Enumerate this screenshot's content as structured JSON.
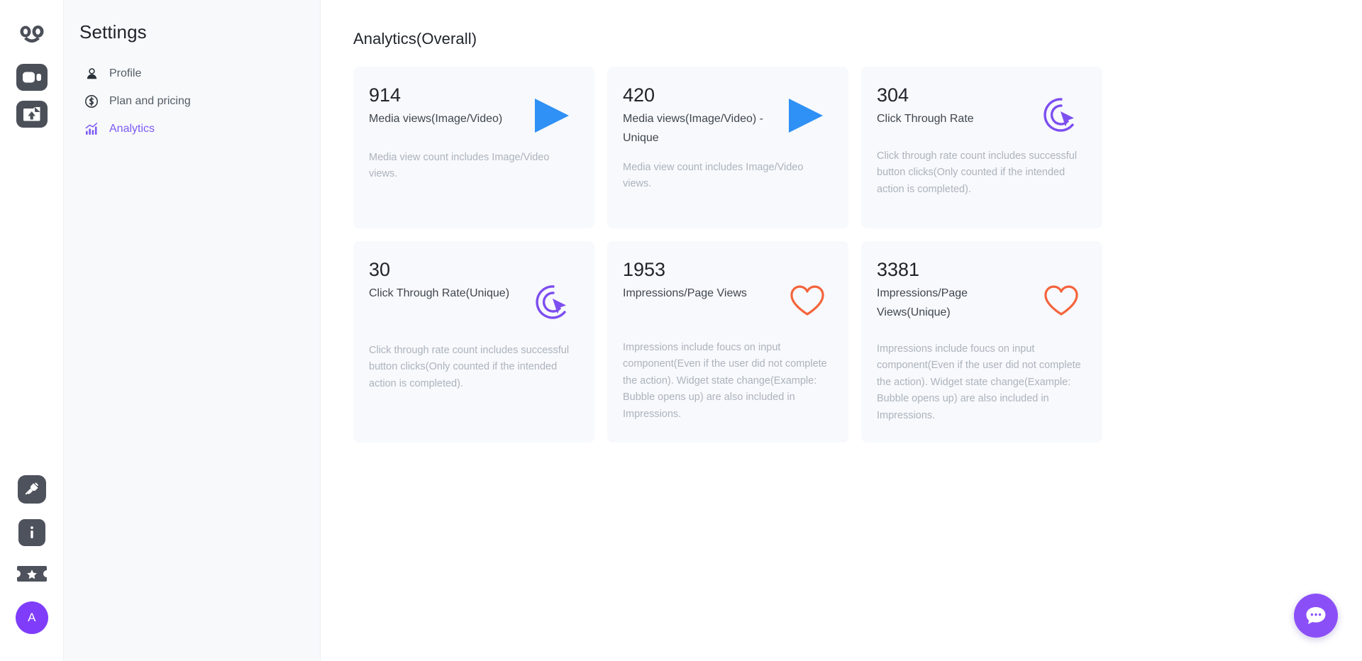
{
  "rail": {
    "logo": {
      "name": "app-logo-smiley"
    },
    "items": [
      {
        "name": "video-icon",
        "label": "Video"
      },
      {
        "name": "upload-icon",
        "label": "Upload"
      }
    ],
    "bottom_items": [
      {
        "name": "plug-integrations-icon",
        "label": "Integrations"
      },
      {
        "name": "info-icon",
        "label": "Info"
      },
      {
        "name": "ticket-star-icon",
        "label": "Rewards"
      }
    ],
    "avatar": {
      "initial": "A"
    }
  },
  "settings": {
    "title": "Settings",
    "nav": [
      {
        "label": "Profile",
        "icon": "person-icon",
        "active": false
      },
      {
        "label": "Plan and pricing",
        "icon": "dollar-circle-icon",
        "active": false
      },
      {
        "label": "Analytics",
        "icon": "chart-bars-icon",
        "active": true
      }
    ]
  },
  "main": {
    "title": "Analytics(Overall)",
    "cards": [
      {
        "value": "914",
        "label": "Media views(Image/Video)",
        "description": "Media view count includes Image/Video views.",
        "icon": "play-icon",
        "icon_color": "#2f90f5"
      },
      {
        "value": "420",
        "label": "Media views(Image/Video) - Unique",
        "description": "Media view count includes Image/Video views.",
        "icon": "play-icon",
        "icon_color": "#2f90f5"
      },
      {
        "value": "304",
        "label": "Click Through Rate",
        "description": "Click through rate count includes successful button clicks(Only counted if the intended action is completed).",
        "icon": "click-target-icon",
        "icon_color": "#7d4ef0"
      },
      {
        "value": "30",
        "label": "Click Through Rate(Unique)",
        "description": "Click through rate count includes successful button clicks(Only counted if the intended action is completed).",
        "icon": "click-target-icon",
        "icon_color": "#7d4ef0"
      },
      {
        "value": "1953",
        "label": "Impressions/Page Views",
        "description": "Impressions include foucs on input component(Even if the user did not complete the action). Widget state change(Example: Bubble opens up) are also included in Impressions.",
        "icon": "heart-icon",
        "icon_color": "#f4643c"
      },
      {
        "value": "3381",
        "label": "Impressions/Page Views(Unique)",
        "description": "Impressions include foucs on input component(Even if the user did not complete the action). Widget state change(Example: Bubble opens up) are also included in Impressions.",
        "icon": "heart-icon",
        "icon_color": "#f4643c"
      }
    ]
  },
  "chat": {
    "name": "chat-launcher",
    "color": "#8b4ff7"
  }
}
